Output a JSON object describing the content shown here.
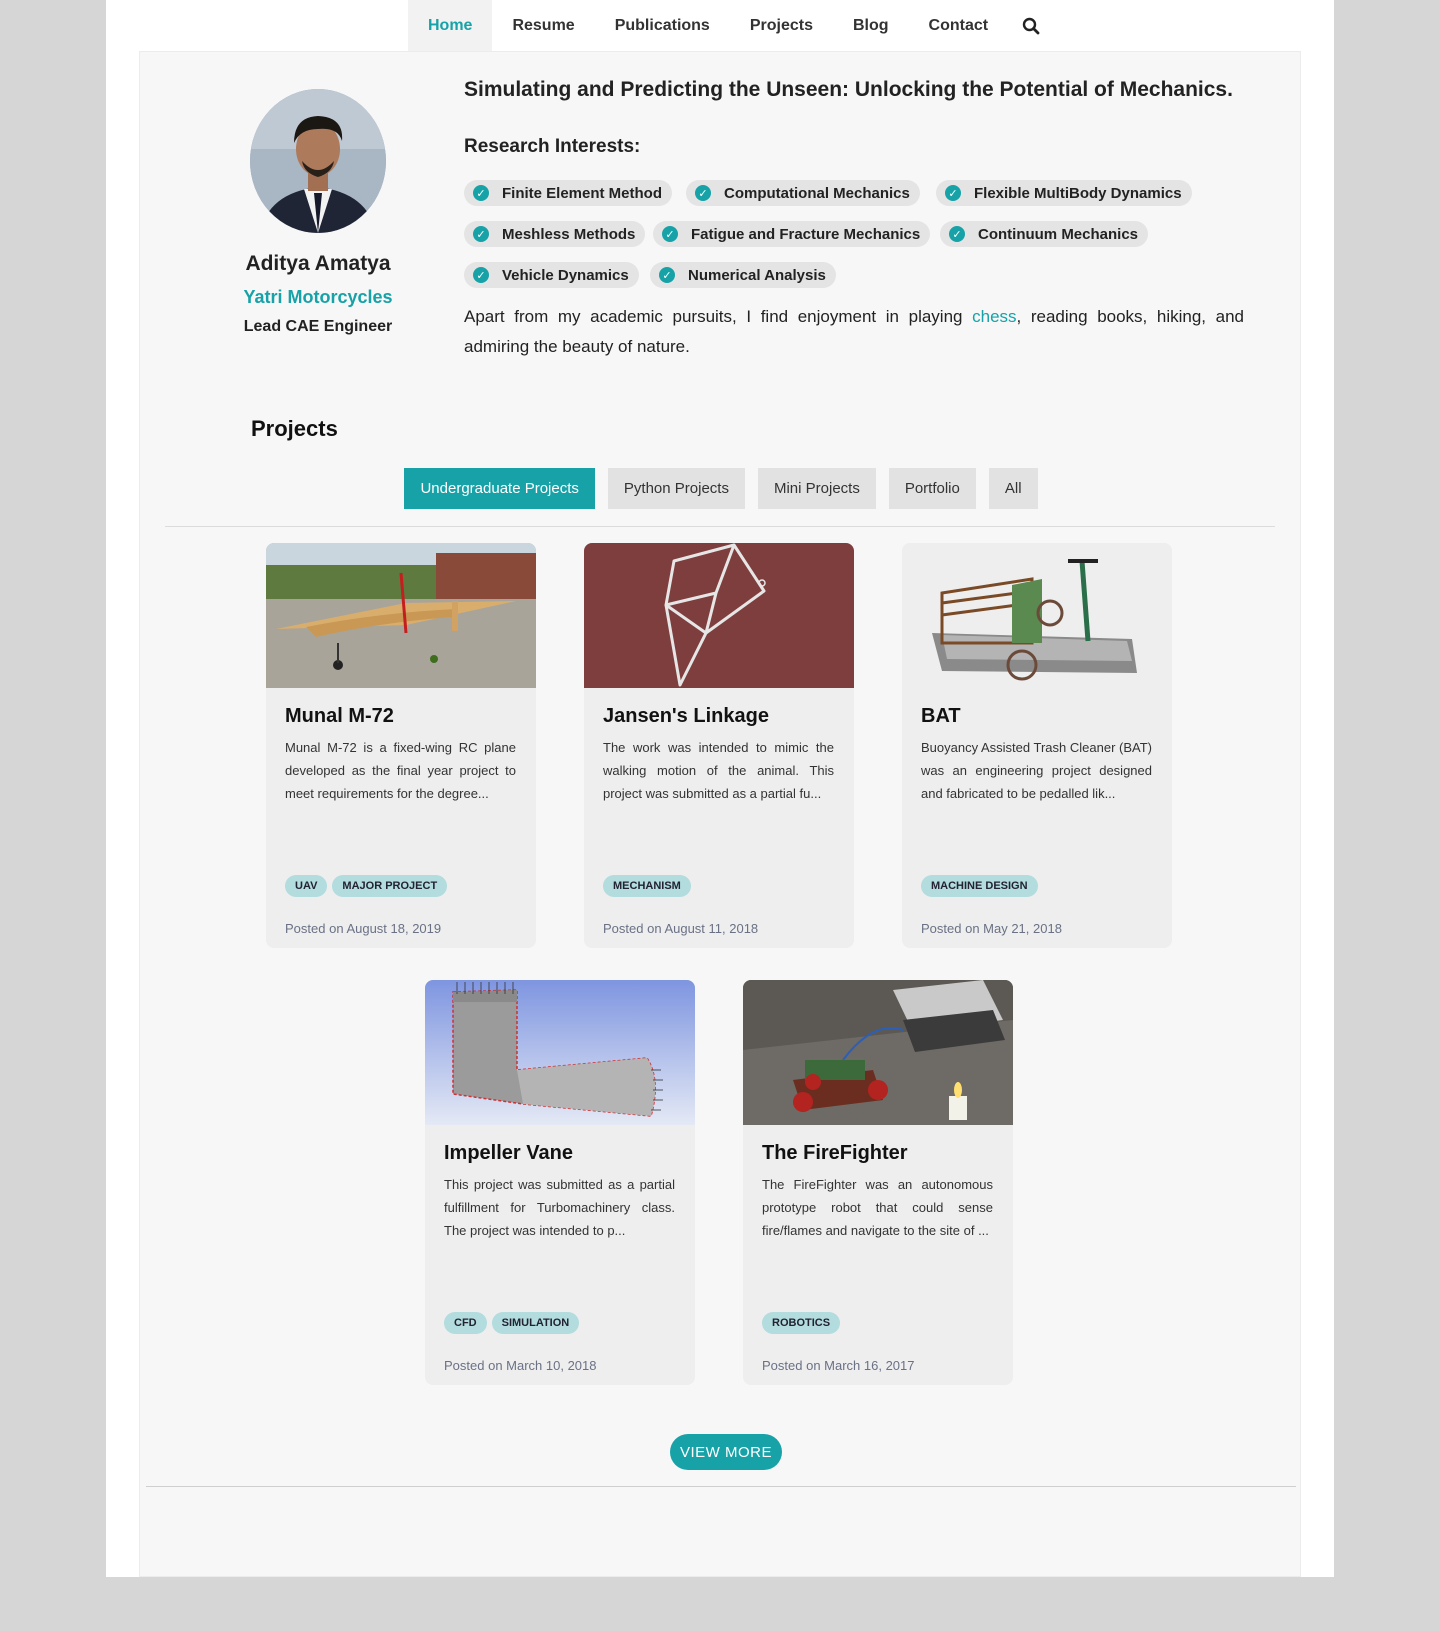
{
  "nav": {
    "items": [
      "Home",
      "Resume",
      "Publications",
      "Projects",
      "Blog",
      "Contact"
    ],
    "active": "Home",
    "search_icon": "search-icon"
  },
  "profile": {
    "name": "Aditya Amatya",
    "company": "Yatri Motorcycles",
    "role": "Lead CAE Engineer"
  },
  "intro": {
    "headline": "Simulating and Predicting the Unseen: Unlocking the Potential of Mechanics.",
    "interests_title": "Research Interests:",
    "interests": [
      "Finite Element Method",
      "Computational Mechanics",
      "Flexible MultiBody Dynamics",
      "Meshless Methods",
      "Fatigue and Fracture Mechanics",
      "Continuum Mechanics",
      "Vehicle Dynamics",
      "Numerical Analysis"
    ],
    "about_before": "Apart from my academic pursuits, I find enjoyment in playing ",
    "about_link": "chess",
    "about_after": ", reading books, hiking, and admiring the beauty of nature."
  },
  "projects": {
    "heading": "Projects",
    "filters": [
      "Undergraduate Projects",
      "Python Projects",
      "Mini Projects",
      "Portfolio",
      "All"
    ],
    "active_filter": "Undergraduate Projects",
    "cards": [
      {
        "title": "Munal M-72",
        "text": "Munal M-72 is a fixed-wing RC plane developed as the final year project to meet requirements for the degree...",
        "tags": [
          "UAV",
          "MAJOR PROJECT"
        ],
        "posted": "Posted on August 18, 2019"
      },
      {
        "title": "Jansen's Linkage",
        "text": "The work was intended to mimic the walking motion of the animal. This project was submitted as a partial fu...",
        "tags": [
          "MECHANISM"
        ],
        "posted": "Posted on August 11, 2018"
      },
      {
        "title": "BAT",
        "text": "Buoyancy Assisted Trash Cleaner (BAT) was an engineering project designed and fabricated to be pedalled lik...",
        "tags": [
          "MACHINE DESIGN"
        ],
        "posted": "Posted on May 21, 2018"
      },
      {
        "title": "Impeller Vane",
        "text": "This project was submitted as a partial fulfillment for Turbomachinery class. The project was intended to p...",
        "tags": [
          "CFD",
          "SIMULATION"
        ],
        "posted": "Posted on March 10, 2018"
      },
      {
        "title": "The FireFighter",
        "text": "The FireFighter was an autonomous prototype robot that could sense fire/flames and navigate to the site of ...",
        "tags": [
          "ROBOTICS"
        ],
        "posted": "Posted on March 16, 2017"
      }
    ],
    "view_more": "VIEW MORE"
  },
  "colors": {
    "accent": "#17a2a8",
    "tag_bg": "#b2dcde",
    "jansen_bg": "#7e3e3e"
  }
}
